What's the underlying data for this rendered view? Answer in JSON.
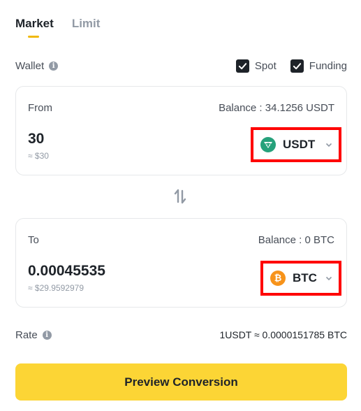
{
  "tabs": [
    {
      "label": "Market",
      "active": true
    },
    {
      "label": "Limit",
      "active": false
    }
  ],
  "wallet": {
    "label": "Wallet",
    "info_icon": "info-icon",
    "options": [
      {
        "label": "Spot",
        "checked": true
      },
      {
        "label": "Funding",
        "checked": true
      }
    ]
  },
  "from": {
    "label": "From",
    "balance": "Balance : 34.1256 USDT",
    "amount": "30",
    "amount_usd": "≈ $30",
    "coin": "USDT",
    "coin_icon": "usdt-icon",
    "coin_color": "#26a17b"
  },
  "swap_icon": "swap-arrows-icon",
  "to": {
    "label": "To",
    "balance": "Balance : 0 BTC",
    "amount": "0.00045535",
    "amount_usd": "≈ $29.9592979",
    "coin": "BTC",
    "coin_icon": "btc-icon",
    "coin_color": "#f7931a"
  },
  "rate": {
    "label": "Rate",
    "value": "1USDT ≈ 0.0000151785 BTC"
  },
  "preview_button": "Preview Conversion",
  "colors": {
    "accent": "#fcd535",
    "tab_underline": "#f0b90b",
    "highlight_border": "#ff0000"
  }
}
